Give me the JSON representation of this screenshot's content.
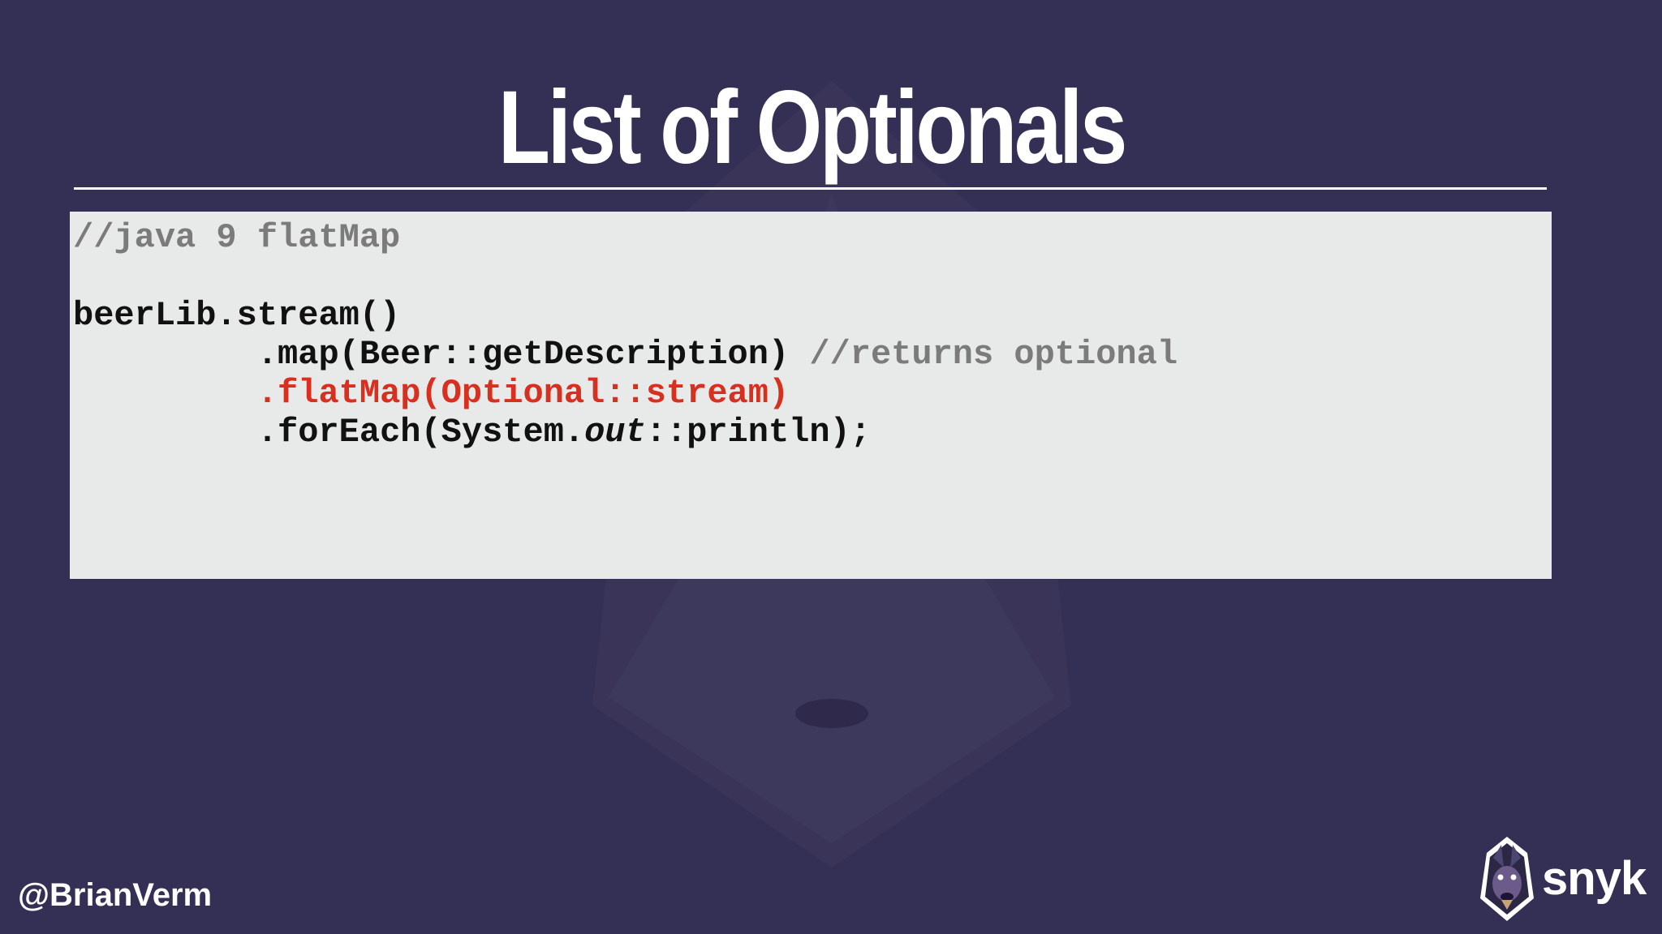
{
  "slide": {
    "title": "List of Optionals",
    "code": {
      "comment_line": "//java 9 flatMap",
      "line2": "beerLib.stream()",
      "line3_indent": "         ",
      "line3_code": ".map(Beer::getDescription) ",
      "line3_comment": "//returns optional",
      "line4_indent": "         ",
      "line4_code": ".flatMap(Optional::stream)",
      "line5_indent": "         ",
      "line5_pre": ".forEach(System.",
      "line5_italic": "out",
      "line5_post": "::println);"
    },
    "handle": "@BrianVerm",
    "logo_text": "snyk"
  },
  "colors": {
    "background": "#342f54",
    "code_background": "#e8e9e9",
    "comment": "#7b7b7b",
    "highlight": "#d7301f"
  },
  "icons": {
    "watermark": "snyk-dog-watermark-icon",
    "logo": "snyk-dog-logo-icon"
  }
}
